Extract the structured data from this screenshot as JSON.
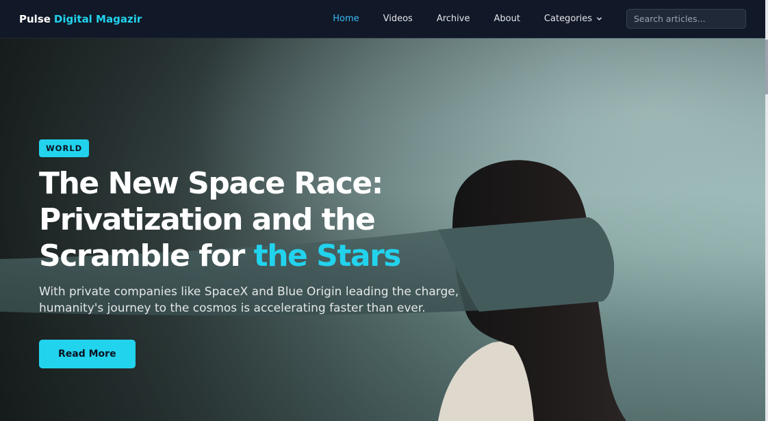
{
  "brand": {
    "first": "Pulse",
    "second": "Digital Magazir"
  },
  "nav": {
    "items": [
      {
        "label": "Home",
        "active": true
      },
      {
        "label": "Videos"
      },
      {
        "label": "Archive"
      },
      {
        "label": "About"
      }
    ],
    "dropdown_label": "Categories",
    "search_placeholder": "Search articles..."
  },
  "hero": {
    "badge": "WORLD",
    "title_main": "The New Space Race: Privatization and the Scramble for",
    "title_accent": "the Stars",
    "subtitle": "With private companies like SpaceX and Blue Origin leading the charge, humanity's journey to the cosmos is accelerating faster than ever.",
    "cta_label": "Read More"
  },
  "colors": {
    "accent": "#22d3ee",
    "nav_bg": "#111827",
    "active_link": "#38bdf8"
  },
  "icons": {
    "dropdown": "chevron-down-icon"
  }
}
